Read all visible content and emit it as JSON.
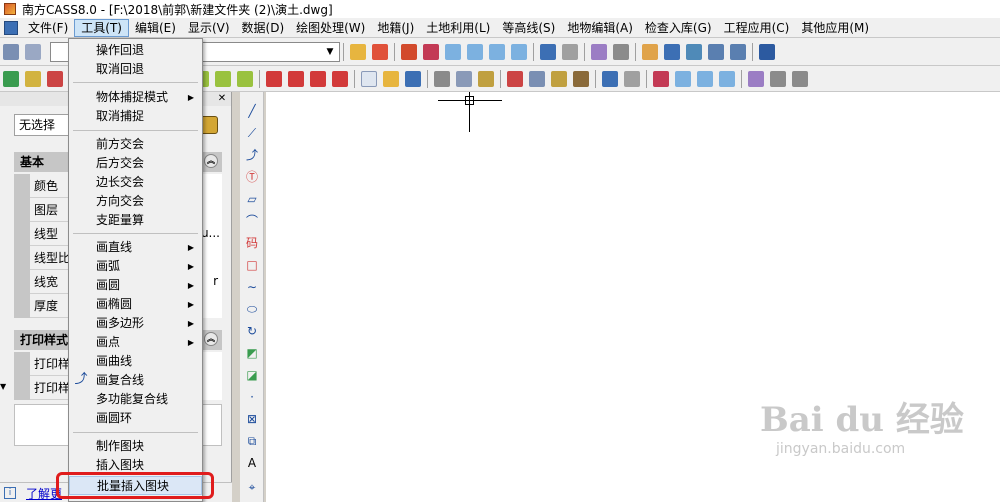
{
  "titlebar": {
    "title": "南方CASS8.0 - [F:\\2018\\前郭\\新建文件夹 (2)\\演土.dwg]"
  },
  "menubar": {
    "items": [
      {
        "label": "文件(F)"
      },
      {
        "label": "工具(T)"
      },
      {
        "label": "编辑(E)"
      },
      {
        "label": "显示(V)"
      },
      {
        "label": "数据(D)"
      },
      {
        "label": "绘图处理(W)"
      },
      {
        "label": "地籍(J)"
      },
      {
        "label": "土地利用(L)"
      },
      {
        "label": "等高线(S)"
      },
      {
        "label": "地物编辑(A)"
      },
      {
        "label": "检查入库(G)"
      },
      {
        "label": "工程应用(C)"
      },
      {
        "label": "其他应用(M)"
      }
    ]
  },
  "tools_menu": {
    "groups": [
      [
        "操作回退",
        "取消回退"
      ],
      [
        "物体捕捉模式",
        "取消捕捉"
      ],
      [
        "前方交会",
        "后方交会",
        "边长交会",
        "方向交会",
        "支距量算"
      ],
      [
        "画直线",
        "画弧",
        "画圆",
        "画椭圆",
        "画多边形",
        "画点",
        "画曲线",
        "画复合线",
        "多功能复合线",
        "画圆环"
      ],
      [
        "制作图块",
        "插入图块",
        "批量插入图块"
      ]
    ],
    "submenu_items": [
      "物体捕捉模式",
      "画直线",
      "画弧",
      "画圆",
      "画椭圆",
      "画多边形",
      "画点"
    ],
    "highlighted_item": "批量插入图块"
  },
  "properties_panel": {
    "selection": "无选择",
    "basic_section": "基本",
    "basic_rows": [
      {
        "label": "颜色"
      },
      {
        "label": "图层"
      },
      {
        "label": "线型",
        "value_suffix": "u..."
      },
      {
        "label": "线型比"
      },
      {
        "label": "线宽",
        "value_suffix": "r"
      },
      {
        "label": "厚度"
      }
    ],
    "print_section": "打印样式",
    "print_rows": [
      {
        "label": "打印样"
      },
      {
        "label": "打印样"
      }
    ],
    "footer_link": "了解更"
  },
  "draw_toolbar": {
    "buttons": [
      "line-icon",
      "polyline-icon",
      "arc-polyline-icon",
      "tp-icon",
      "rectangle-icon",
      "arc-icon",
      "code-icon",
      "square-icon",
      "curve-icon",
      "ellipse-icon",
      "circle-arrow-icon",
      "shape-icon",
      "shape2-icon",
      "point-icon",
      "hatch-icon",
      "region-icon",
      "text-icon",
      "more-icon"
    ],
    "code_label": "码",
    "text_label": "A"
  },
  "watermark": {
    "main": "Bai du 经验",
    "sub": "jingyan.baidu.com"
  },
  "colors": {
    "highlight_outline": "#e01c1c",
    "menu_active_bg": "#cde4f7"
  }
}
